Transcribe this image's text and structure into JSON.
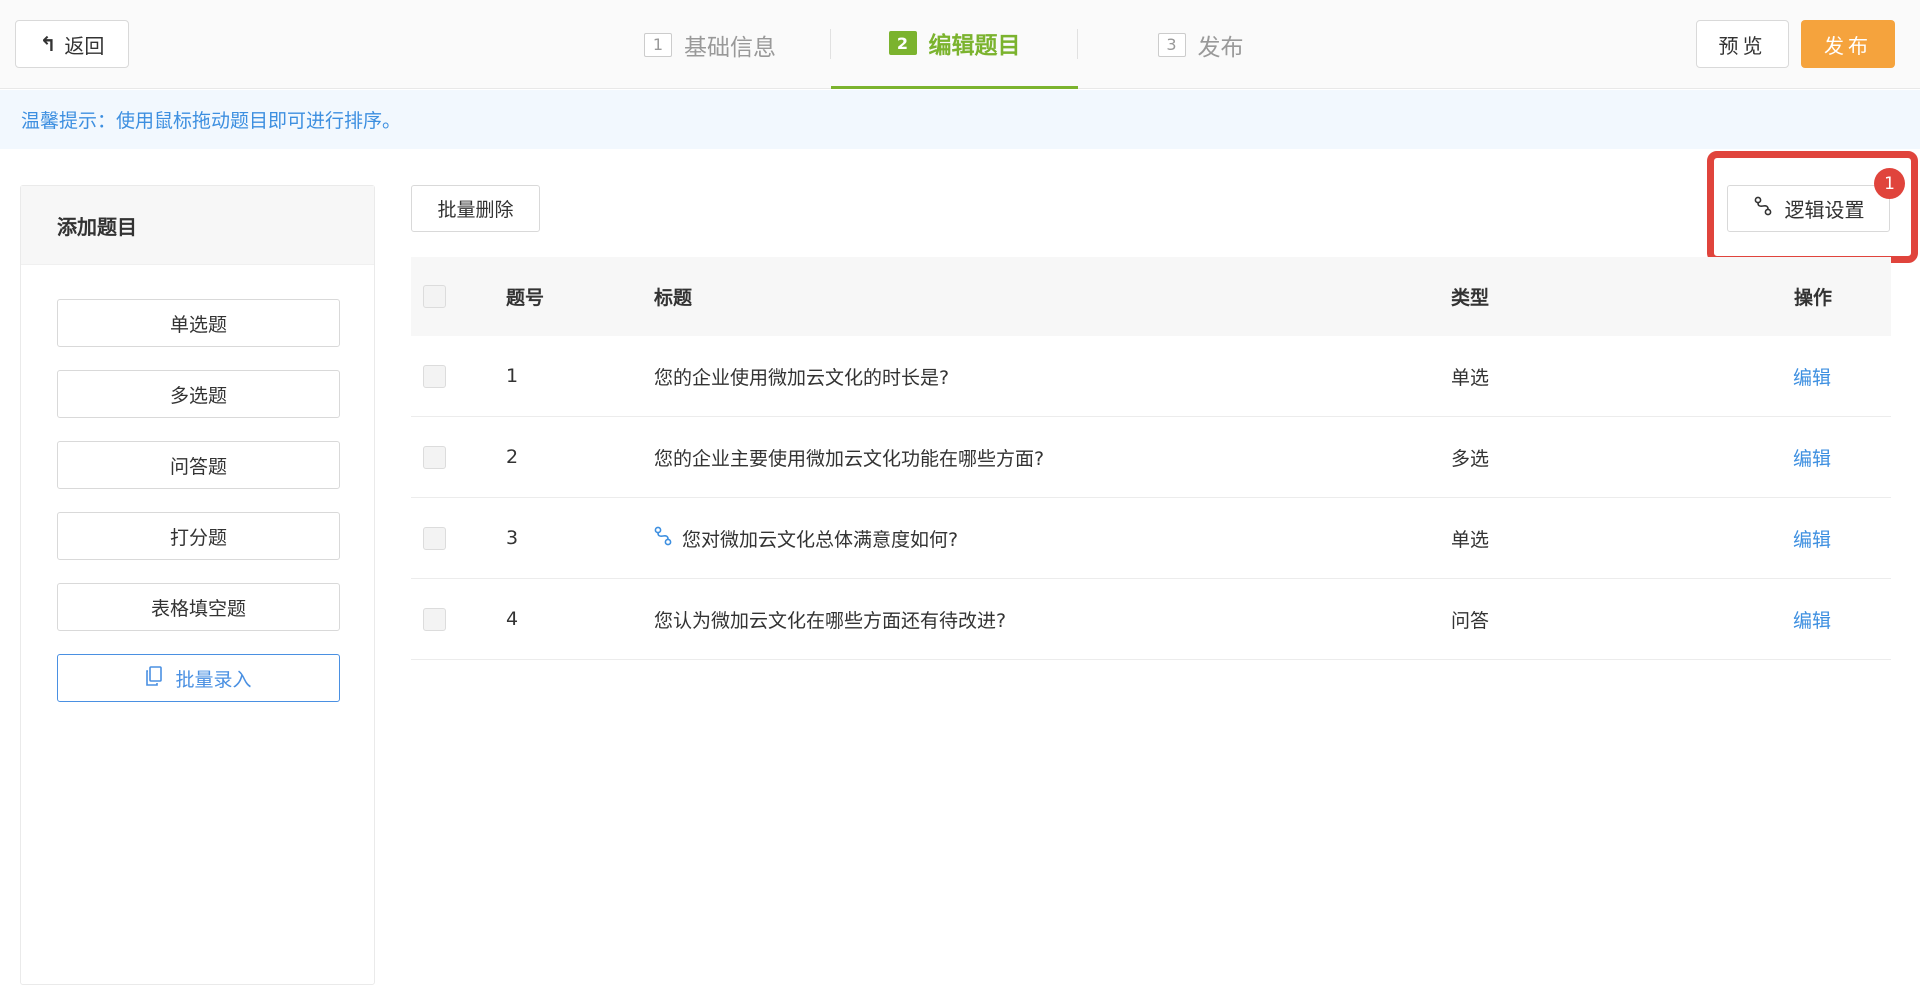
{
  "header": {
    "back_label": "返回",
    "steps": [
      {
        "num": "1",
        "label": "基础信息",
        "active": false
      },
      {
        "num": "2",
        "label": "编辑题目",
        "active": true
      },
      {
        "num": "3",
        "label": "发布",
        "active": false
      }
    ],
    "preview_label": "预览",
    "publish_label": "发布"
  },
  "tip": "温馨提示：使用鼠标拖动题目即可进行排序。",
  "sidebar": {
    "title": "添加题目",
    "buttons": [
      "单选题",
      "多选题",
      "问答题",
      "打分题",
      "表格填空题"
    ],
    "batch_label": "批量录入"
  },
  "toolbar": {
    "bulk_delete_label": "批量删除",
    "logic_label": "逻辑设置",
    "logic_badge": "1"
  },
  "table": {
    "headers": {
      "num": "题号",
      "title": "标题",
      "type": "类型",
      "op": "操作"
    },
    "rows": [
      {
        "num": "1",
        "title": "您的企业使用微加云文化的时长是?",
        "type": "单选",
        "op": "编辑",
        "has_logic": false
      },
      {
        "num": "2",
        "title": "您的企业主要使用微加云文化功能在哪些方面?",
        "type": "多选",
        "op": "编辑",
        "has_logic": false
      },
      {
        "num": "3",
        "title": "您对微加云文化总体满意度如何?",
        "type": "单选",
        "op": "编辑",
        "has_logic": true
      },
      {
        "num": "4",
        "title": "您认为微加云文化在哪些方面还有待改进?",
        "type": "问答",
        "op": "编辑",
        "has_logic": false
      }
    ]
  },
  "colors": {
    "accent_green": "#7bb32e",
    "publish_orange": "#f5a33d",
    "link_blue": "#3d8fe0",
    "highlight_red": "#e0443c"
  }
}
